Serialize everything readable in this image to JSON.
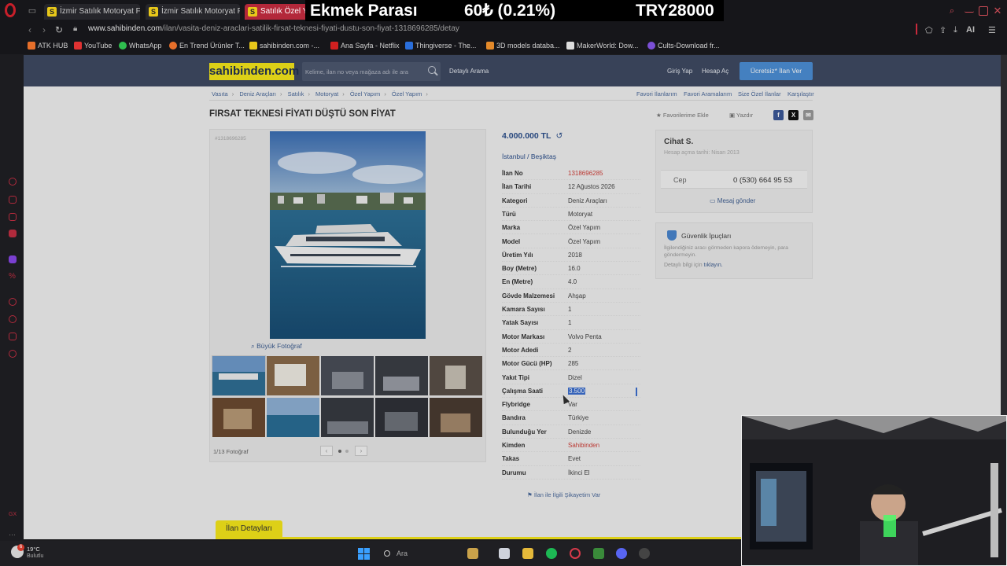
{
  "browser": {
    "tabs": [
      {
        "label": "İzmir Satılık Motoryat Fiyatl",
        "favicon": "S",
        "active": false
      },
      {
        "label": "İzmir Satılık Motoryat Fiyatl",
        "favicon": "S",
        "active": false
      },
      {
        "label": "Satılık Özel Yap",
        "favicon": "S",
        "active": true
      }
    ],
    "url_host": "www.sahibinden.com",
    "url_path": "/ilan/vasita-deniz-araclari-satilik-firsat-teknesi-fiyati-dustu-son-fiyat-1318696285/detay",
    "ai_label": "AI",
    "bookmarks": [
      {
        "label": "ATK HUB",
        "color": "#e76f2a"
      },
      {
        "label": "YouTube",
        "color": "#e03232"
      },
      {
        "label": "WhatsApp",
        "color": "#2fbf4f"
      },
      {
        "label": "En Trend Ürünler T...",
        "color": "#e76f2a"
      },
      {
        "label": "sahibinden.com -...",
        "color": "#e8c81a"
      },
      {
        "label": "Ana Sayfa - Netflix",
        "color": "#d02020"
      },
      {
        "label": "Thingiverse - The...",
        "color": "#2a6fdc"
      },
      {
        "label": "3D models databa...",
        "color": "#e48a2a"
      },
      {
        "label": "MakerWorld: Dow...",
        "color": "#dddddd"
      },
      {
        "label": "Cults-Download fr...",
        "color": "#7b4fd6"
      }
    ]
  },
  "ticker": {
    "label": "Ekmek Parası",
    "change": "60₺ (0.21%)",
    "total": "TRY28000"
  },
  "site": {
    "brand": "sahibinden.com",
    "search_placeholder": "Kelime, ilan no veya mağaza adı ile ara",
    "detailed_search": "Detaylı Arama",
    "login": "Giriş Yap",
    "register": "Hesap Aç",
    "post_ad": "Ücretsiz* İlan Ver",
    "breadcrumb": [
      "Vasıta",
      "Deniz Araçları",
      "Satılık",
      "Motoryat",
      "Özel Yapım",
      "Özel Yapım"
    ],
    "top_links": [
      "Favori İlanlarım",
      "Favori Aramalarım",
      "Size Özel İlanlar",
      "Karşılaştır"
    ]
  },
  "listing": {
    "title": "FIRSAT TEKNESİ FİYATI DÜŞTÜ SON FİYAT",
    "add_favorite": "Favorilerime Ekle",
    "print": "Yazdır",
    "id_small": "#1318696285",
    "big_photo": "Büyük Fotoğraf",
    "photo_count": "1/13 Fotoğraf",
    "price": "4.000.000 TL",
    "location_city": "İstanbul",
    "location_district": "Beşiktaş",
    "specs": [
      {
        "key": "İlan No",
        "value": "1318696285",
        "style": "red"
      },
      {
        "key": "İlan Tarihi",
        "value": "12 Ağustos 2026",
        "style": ""
      },
      {
        "key": "Kategori",
        "value": "Deniz Araçları",
        "style": ""
      },
      {
        "key": "Türü",
        "value": "Motoryat",
        "style": ""
      },
      {
        "key": "Marka",
        "value": "Özel Yapım",
        "style": ""
      },
      {
        "key": "Model",
        "value": "Özel Yapım",
        "style": ""
      },
      {
        "key": "Üretim Yılı",
        "value": "2018",
        "style": ""
      },
      {
        "key": "Boy (Metre)",
        "value": "16.0",
        "style": ""
      },
      {
        "key": "En (Metre)",
        "value": "4.0",
        "style": ""
      },
      {
        "key": "Gövde Malzemesi",
        "value": "Ahşap",
        "style": ""
      },
      {
        "key": "Kamara Sayısı",
        "value": "1",
        "style": ""
      },
      {
        "key": "Yatak Sayısı",
        "value": "1",
        "style": ""
      },
      {
        "key": "Motor Markası",
        "value": "Volvo Penta",
        "style": ""
      },
      {
        "key": "Motor Adedi",
        "value": "2",
        "style": ""
      },
      {
        "key": "Motor Gücü (HP)",
        "value": "285",
        "style": ""
      },
      {
        "key": "Yakıt Tipi",
        "value": "Dizel",
        "style": ""
      },
      {
        "key": "Çalışma Saati",
        "value": "3.500",
        "style": "hl"
      },
      {
        "key": "Flybridge",
        "value": "Var",
        "style": ""
      },
      {
        "key": "Bandıra",
        "value": "Türkiye",
        "style": ""
      },
      {
        "key": "Bulunduğu Yer",
        "value": "Denizde",
        "style": ""
      },
      {
        "key": "Kimden",
        "value": "Sahibinden",
        "style": "red"
      },
      {
        "key": "Takas",
        "value": "Evet",
        "style": ""
      },
      {
        "key": "Durumu",
        "value": "İkinci El",
        "style": ""
      }
    ],
    "report": "İlan ile İlgili Şikayetim Var",
    "details_tab": "İlan Detayları"
  },
  "seller": {
    "name": "Cihat S.",
    "member_since": "Hesap açma tarihi: Nisan 2013",
    "phone_label": "Cep",
    "phone": "0 (530) 664 95 53",
    "message": "Mesaj gönder"
  },
  "security": {
    "title": "Güvenlik İpuçları",
    "text": "İlgilendiğiniz aracı görmeden kapora ödemeyin, para göndermeyin.",
    "more_prefix": "Detaylı bilgi için",
    "more_link": "tıklayın."
  },
  "taskbar": {
    "weather_badge": "6",
    "temperature": "19°C",
    "condition": "Bulutlu",
    "search": "Ara"
  },
  "colors": {
    "brand_yellow": "#f6e81a",
    "header_navy": "#3f4a63",
    "link_blue": "#2b4f8c",
    "accent_red": "#b3283a"
  }
}
